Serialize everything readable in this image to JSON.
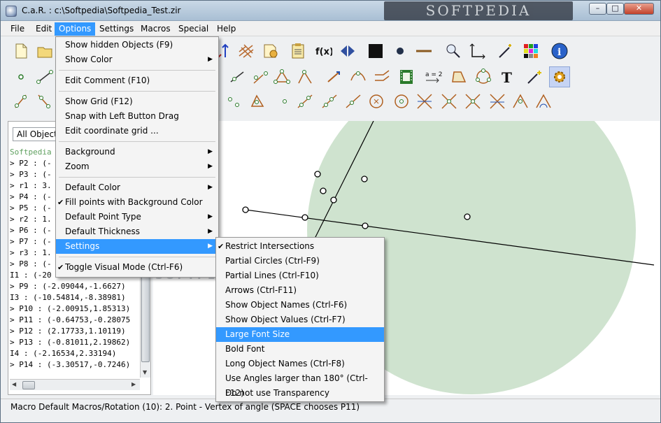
{
  "window": {
    "title": "C.a.R. : c:\\Softpedia\\Softpedia_Test.zir",
    "watermark": "SOFTPEDIA"
  },
  "caption_buttons": {
    "minimize": "–",
    "maximize": "□",
    "close": "✕"
  },
  "menubar": [
    "File",
    "Edit",
    "Options",
    "Settings",
    "Macros",
    "Special",
    "Help"
  ],
  "options_menu": [
    {
      "label": "Show hidden Objects (F9)"
    },
    {
      "label": "Show Color",
      "submenu": true
    },
    {
      "separator": true
    },
    {
      "label": "Edit Comment (F10)"
    },
    {
      "separator": true
    },
    {
      "label": "Show Grid (F12)"
    },
    {
      "label": "Snap with Left Button Drag"
    },
    {
      "label": "Edit coordinate grid ..."
    },
    {
      "separator": true
    },
    {
      "label": "Background",
      "submenu": true
    },
    {
      "label": "Zoom",
      "submenu": true
    },
    {
      "separator": true
    },
    {
      "label": "Default Color",
      "submenu": true
    },
    {
      "label": "Fill points with Background Color",
      "checked": true
    },
    {
      "label": "Default Point Type",
      "submenu": true
    },
    {
      "label": "Default Thickness",
      "submenu": true
    },
    {
      "label": "Settings",
      "submenu": true,
      "highlighted": true
    },
    {
      "separator": true
    },
    {
      "label": "Toggle Visual Mode (Ctrl-F6)",
      "checked": true
    }
  ],
  "settings_submenu": [
    {
      "label": "Restrict Intersections",
      "checked": true
    },
    {
      "label": "Partial Circles (Ctrl-F9)"
    },
    {
      "label": "Partial Lines (Ctrl-F10)"
    },
    {
      "label": "Arrows (Ctrl-F11)"
    },
    {
      "label": "Show Object Names (Ctrl-F6)"
    },
    {
      "label": "Show Object Values (Ctrl-F7)"
    },
    {
      "label": "Large Font Size",
      "highlighted": true
    },
    {
      "label": "Bold Font"
    },
    {
      "label": "Long Object Names (Ctrl-F8)"
    },
    {
      "label": "Use Angles larger than 180° (Ctrl-F12)"
    },
    {
      "label": "Do not use Transparency"
    }
  ],
  "object_filter": "All Objects",
  "object_list": [
    "Softpedia",
    "> P2 : (-",
    "> P3 : (-",
    "> r1 : 3.",
    "> P4 : (-",
    "> P5 : (-",
    "> r2 : 1.",
    "> P6 : (-",
    "> P7 : (-",
    "> r3 : 1.",
    "> P8 : (-",
    "I1 : (-20",
    "> P9 : (-2.09044,-1.6627)",
    "I3 : (-10.54814,-8.38981)",
    "> P10 : (-2.00915,1.85313)",
    "> P11 : (-0.64753,-0.28075",
    "> P12 : (2.17733,1.10119)",
    "> P13 : (-0.81011,2.19862)",
    "I4 : (-2.16534,2.33194)",
    "> P14 : (-3.30517,-0.7246)"
  ],
  "status": "Macro Default Macros/Rotation (10): 2. Point - Vertex of angle  (SPACE chooses P11)",
  "canvas_watermark": "SOFTPEDIA",
  "colors": {
    "accent": "#3399ff",
    "circle_fill": "#cfe3cf",
    "hdr_green": "#5fa05f"
  },
  "toolbar_rows": [
    [
      "new-file",
      "open-folder",
      "hidden",
      "hidden",
      "hidden",
      "hidden",
      "hidden",
      "hidden",
      "hidden",
      "hidden",
      "sort-arrows",
      "grid-lines",
      "export",
      "clipboard",
      "function",
      "flip",
      "black-square",
      "point-style",
      "line-style",
      "zoom-move",
      "axes",
      "wand",
      "color-palette",
      "info"
    ],
    [
      "point",
      "line-segment",
      "hidden",
      "hidden",
      "hidden",
      "hidden",
      "hidden",
      "hidden",
      "hidden",
      "hidden",
      "hidden",
      "angle-tool",
      "ray",
      "curve",
      "parallel",
      "film",
      "equation",
      "quadrilateral",
      "circle-points",
      "text",
      "magic-wand",
      "gear"
    ],
    [
      "midpoint",
      "reflect",
      "hidden",
      "hidden",
      "hidden",
      "hidden",
      "hidden",
      "hidden",
      "hidden",
      "hidden",
      "triangle-points",
      "point-on-line",
      "line-points",
      "ray-points",
      "segment-points",
      "circle-center",
      "circle-center-2",
      "cross-lines",
      "cross-lines-2",
      "cross-lines-3",
      "cross-lines-4",
      "angle-bisector",
      "angle-mark"
    ]
  ]
}
